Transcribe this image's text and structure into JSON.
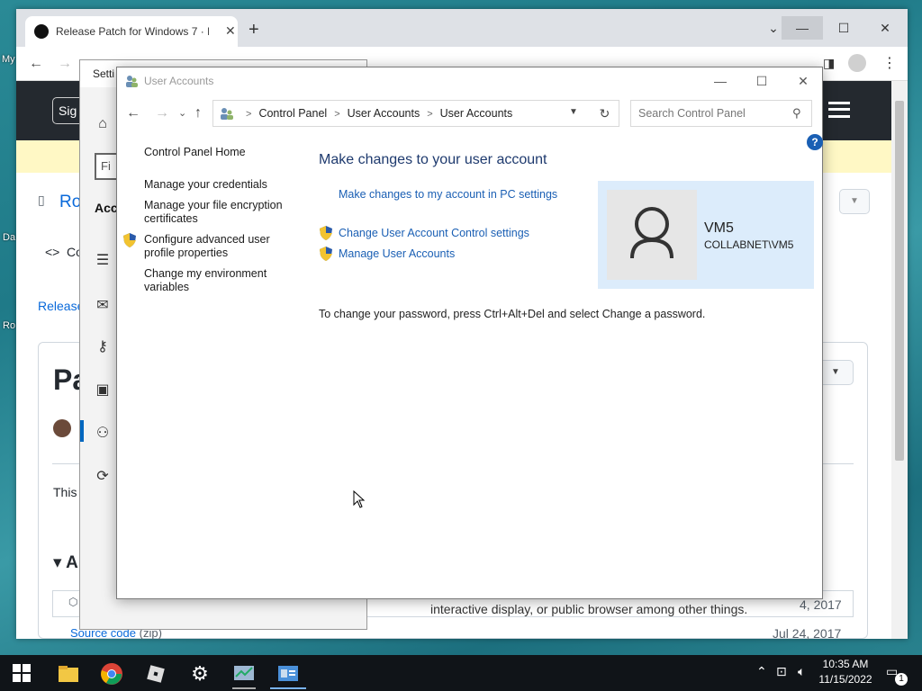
{
  "desktop": {
    "labels": [
      "My",
      "Da",
      "Ro"
    ]
  },
  "browser": {
    "tab_title": "Release Patch for Windows 7 · Ro",
    "signin_label": "Sig",
    "breadcrumb_partial": "Ro",
    "code_tab_partial": "Co",
    "release_link_partial": "Release",
    "heading_partial": "Pa",
    "body_partial": "This",
    "assets_partial": "A",
    "source_code_label": "Source code",
    "source_code_ext": "(zip)",
    "asset_date_1": "4, 2017",
    "asset_date_2": "Jul 24, 2017",
    "asset_text": "interactive display, or public browser among other things."
  },
  "settings": {
    "title_partial": "Setti",
    "find_partial": "Fi",
    "section_partial": "Acc"
  },
  "user_accounts": {
    "window_title": "User Accounts",
    "breadcrumbs": [
      "Control Panel",
      "User Accounts",
      "User Accounts"
    ],
    "search_placeholder": "Search Control Panel",
    "help_label": "?",
    "nav": {
      "home": "Control Panel Home",
      "credentials": "Manage your credentials",
      "encryption": "Manage your file encryption certificates",
      "advanced_profile": "Configure advanced user profile properties",
      "env_vars": "Change my environment variables"
    },
    "heading": "Make changes to your user account",
    "links": {
      "pc_settings": "Make changes to my account in PC settings",
      "uac": "Change User Account Control settings",
      "manage": "Manage User Accounts"
    },
    "password_note": "To change your password, press Ctrl+Alt+Del and select Change a password.",
    "user": {
      "name": "VM5",
      "domain": "COLLABNET\\VM5"
    }
  },
  "taskbar": {
    "time": "10:35 AM",
    "date": "11/15/2022",
    "notification_count": "1"
  },
  "colors": {
    "link": "#1a5fb4",
    "heading": "#1e3a6e",
    "user_card": "#dcecfb",
    "taskbar": "#101418"
  }
}
